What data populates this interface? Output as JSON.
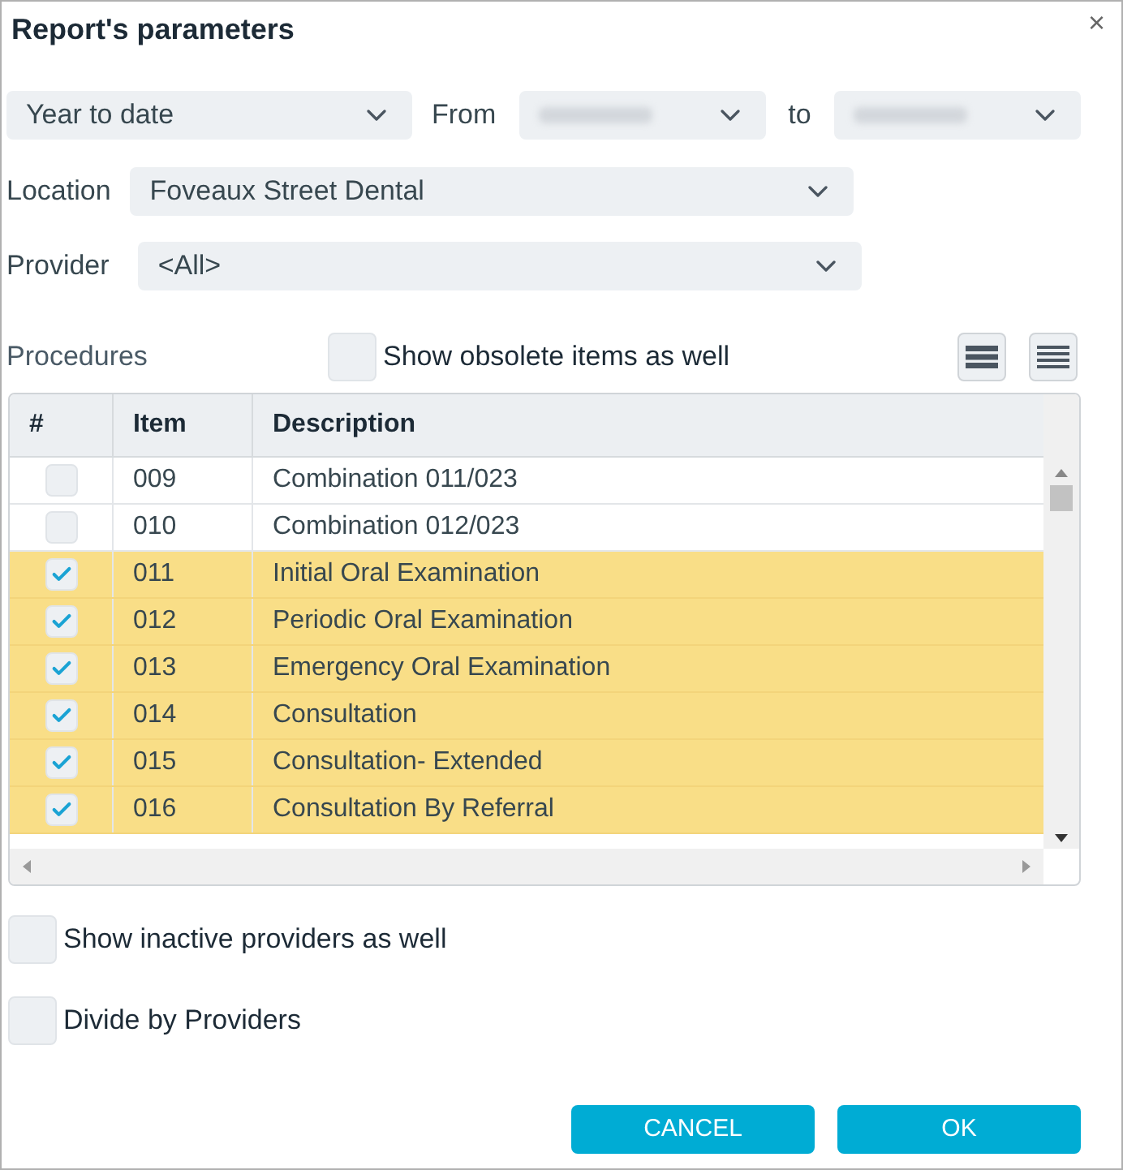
{
  "window": {
    "title": "Report's parameters",
    "close": "×"
  },
  "period": {
    "value": "Year to date",
    "from_label": "From",
    "to_label": "to"
  },
  "location": {
    "label": "Location",
    "value": "Foveaux Street Dental"
  },
  "provider": {
    "label": "Provider",
    "value": "<All>"
  },
  "procedures": {
    "label": "Procedures",
    "show_obsolete": {
      "label": "Show obsolete items as well",
      "checked": false
    }
  },
  "table": {
    "columns": [
      "#",
      "Item",
      "Description"
    ],
    "rows": [
      {
        "item": "009",
        "description": "Combination 011/023",
        "checked": false
      },
      {
        "item": "010",
        "description": "Combination 012/023",
        "checked": false
      },
      {
        "item": "011",
        "description": "Initial Oral Examination",
        "checked": true
      },
      {
        "item": "012",
        "description": "Periodic Oral Examination",
        "checked": true
      },
      {
        "item": "013",
        "description": "Emergency Oral Examination",
        "checked": true
      },
      {
        "item": "014",
        "description": "Consultation",
        "checked": true
      },
      {
        "item": "015",
        "description": "Consultation- Extended",
        "checked": true
      },
      {
        "item": "016",
        "description": "Consultation By Referral",
        "checked": true
      }
    ]
  },
  "options": [
    {
      "label": "Show inactive providers as well",
      "checked": false
    },
    {
      "label": "Divide by Providers",
      "checked": false
    }
  ],
  "buttons": [
    "CANCEL",
    "OK"
  ]
}
